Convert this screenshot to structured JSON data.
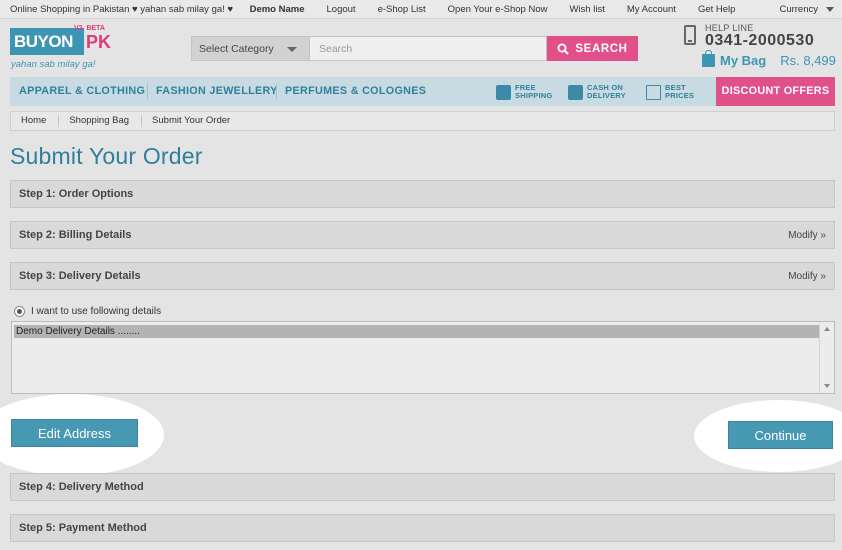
{
  "topbar": {
    "tagline": "Online Shopping in Pakistan ♥ yahan sab milay ga! ♥",
    "user": "Demo Name",
    "links": [
      "Logout",
      "e-Shop List",
      "Open Your e-Shop Now",
      "Wish list",
      "My Account",
      "Get Help"
    ],
    "currency": "Currency"
  },
  "logo": {
    "name": "BUYON",
    "suffix": "PK",
    "badge": "V2. BETA",
    "tagline": "yahan sab milay ga!"
  },
  "search": {
    "category": "Select Category",
    "placeholder": "Search",
    "button": "SEARCH"
  },
  "helpline": {
    "label": "HELP LINE",
    "number": "0341-2000530"
  },
  "bag": {
    "label": "My Bag",
    "total": "Rs. 8,499"
  },
  "nav": {
    "categories": [
      "APPAREL & CLOTHING",
      "FASHION JEWELLERY",
      "PERFUMES & COLOGNES"
    ],
    "features": [
      {
        "line1": "FREE",
        "line2": "SHIPPING"
      },
      {
        "line1": "CASH ON",
        "line2": "DELIVERY"
      },
      {
        "line1": "BEST",
        "line2": "PRICES"
      }
    ],
    "offers": "DISCOUNT OFFERS"
  },
  "breadcrumb": [
    "Home",
    "Shopping Bag",
    "Submit Your Order"
  ],
  "page_title": "Submit Your Order",
  "steps": [
    {
      "label": "Step 1: Order Options",
      "modify": ""
    },
    {
      "label": "Step 2: Billing Details",
      "modify": "Modify »"
    },
    {
      "label": "Step 3: Delivery Details",
      "modify": "Modify »"
    },
    {
      "label": "Step 4: Delivery Method",
      "modify": ""
    },
    {
      "label": "Step 5: Payment Method",
      "modify": ""
    }
  ],
  "delivery": {
    "radio_label": "I want to use following details",
    "selected_option": "Demo Delivery Details ........"
  },
  "buttons": {
    "edit": "Edit Address",
    "continue": "Continue"
  }
}
